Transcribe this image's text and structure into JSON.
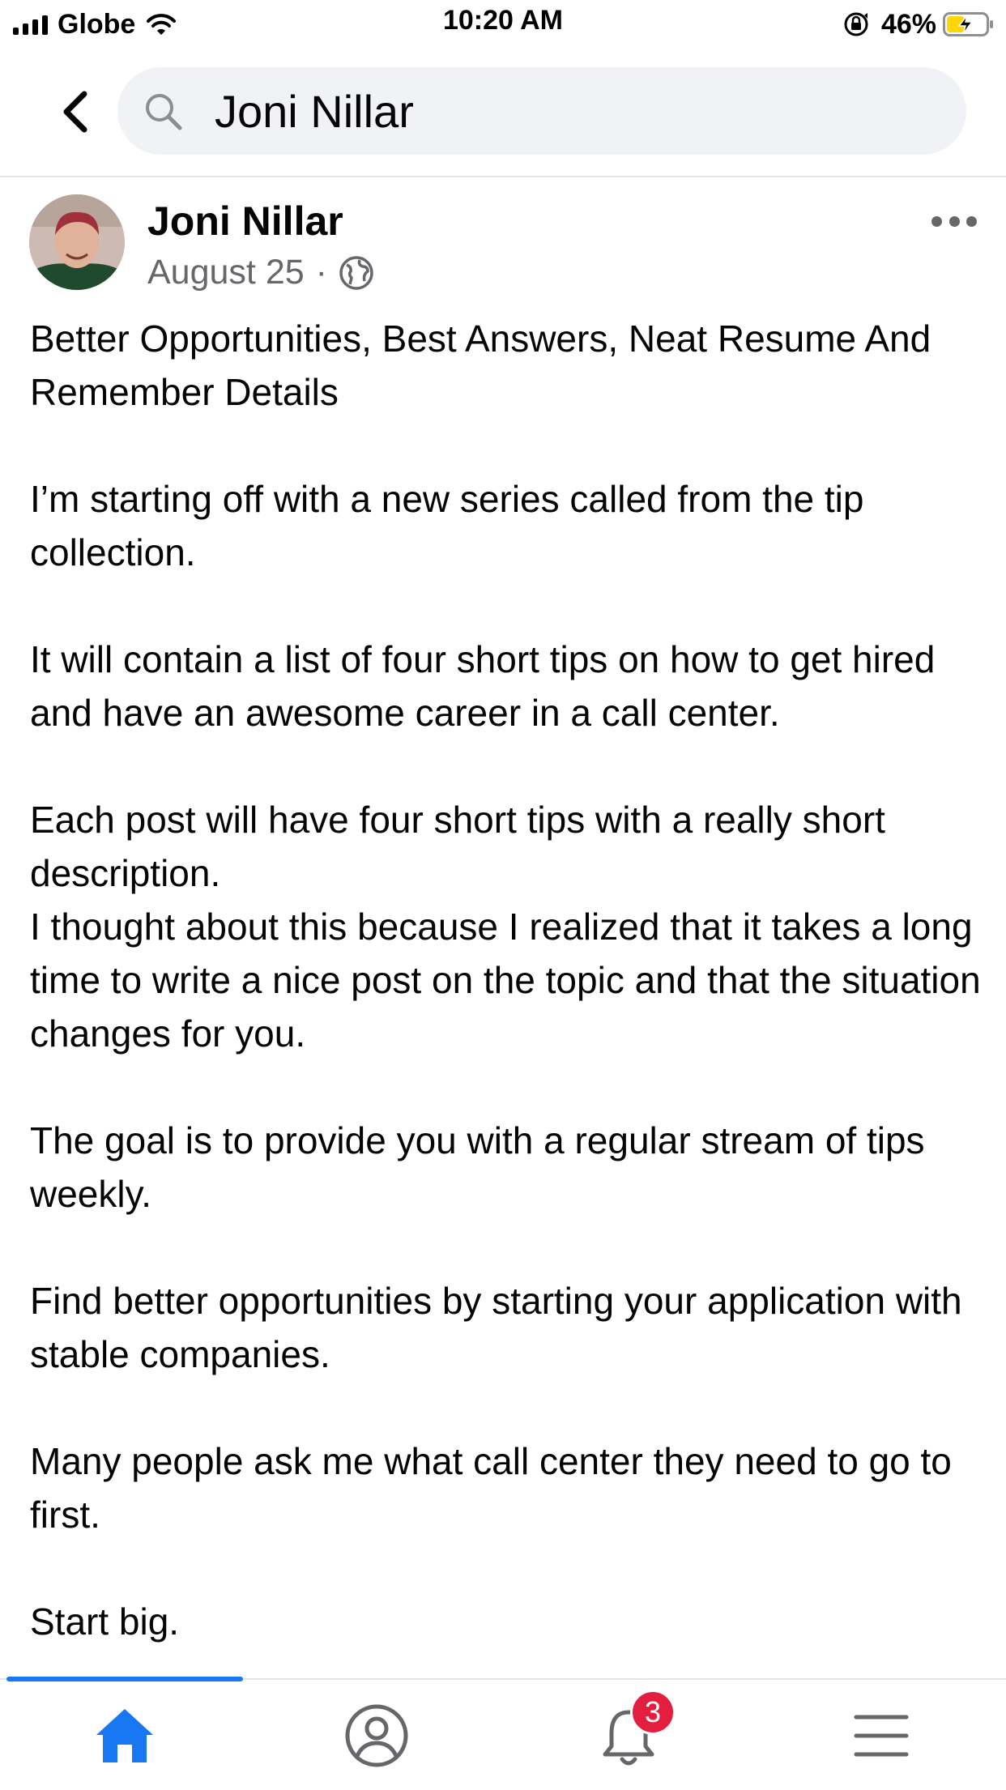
{
  "status_bar": {
    "carrier": "Globe",
    "time": "10:20 AM",
    "battery_percent": "46%",
    "battery_level": 0.46,
    "icons": [
      "signal-icon",
      "wifi-icon",
      "orientation-lock-icon",
      "battery-charging-icon"
    ]
  },
  "search": {
    "query": "Joni Nillar",
    "icons": [
      "back-icon",
      "search-icon"
    ]
  },
  "post": {
    "author": "Joni Nillar",
    "date": "August 25",
    "separator": "·",
    "privacy_icon": "globe-icon",
    "paragraphs": [
      "Better Opportunities, Best Answers, Neat Resume And Remember Details",
      "I’m starting off with a new series called from the tip collection.",
      "It will contain a list of four short tips on how to get hired and have an awesome career in a call center.",
      "Each post will have four short tips with a really short description.",
      "I thought about this because I realized that it takes a long time to write a nice post on the topic and that the situation changes for you.",
      "The goal is to provide you with a regular stream of tips weekly.",
      "Find better opportunities by starting your application with stable companies.",
      "Many people ask me what call center they need to go to first.",
      "Start big."
    ]
  },
  "tabbar": {
    "tabs": [
      {
        "name": "home",
        "icon": "home-icon",
        "active": true
      },
      {
        "name": "profile",
        "icon": "profile-icon",
        "active": false
      },
      {
        "name": "notifications",
        "icon": "bell-icon",
        "active": false,
        "badge": "3"
      },
      {
        "name": "menu",
        "icon": "menu-icon",
        "active": false
      }
    ]
  },
  "colors": {
    "accent": "#1877f2",
    "badge": "#e41e3f",
    "secondary_text": "#65676b",
    "search_bg": "#f0f2f5",
    "battery_fill": "#ffd60a"
  }
}
